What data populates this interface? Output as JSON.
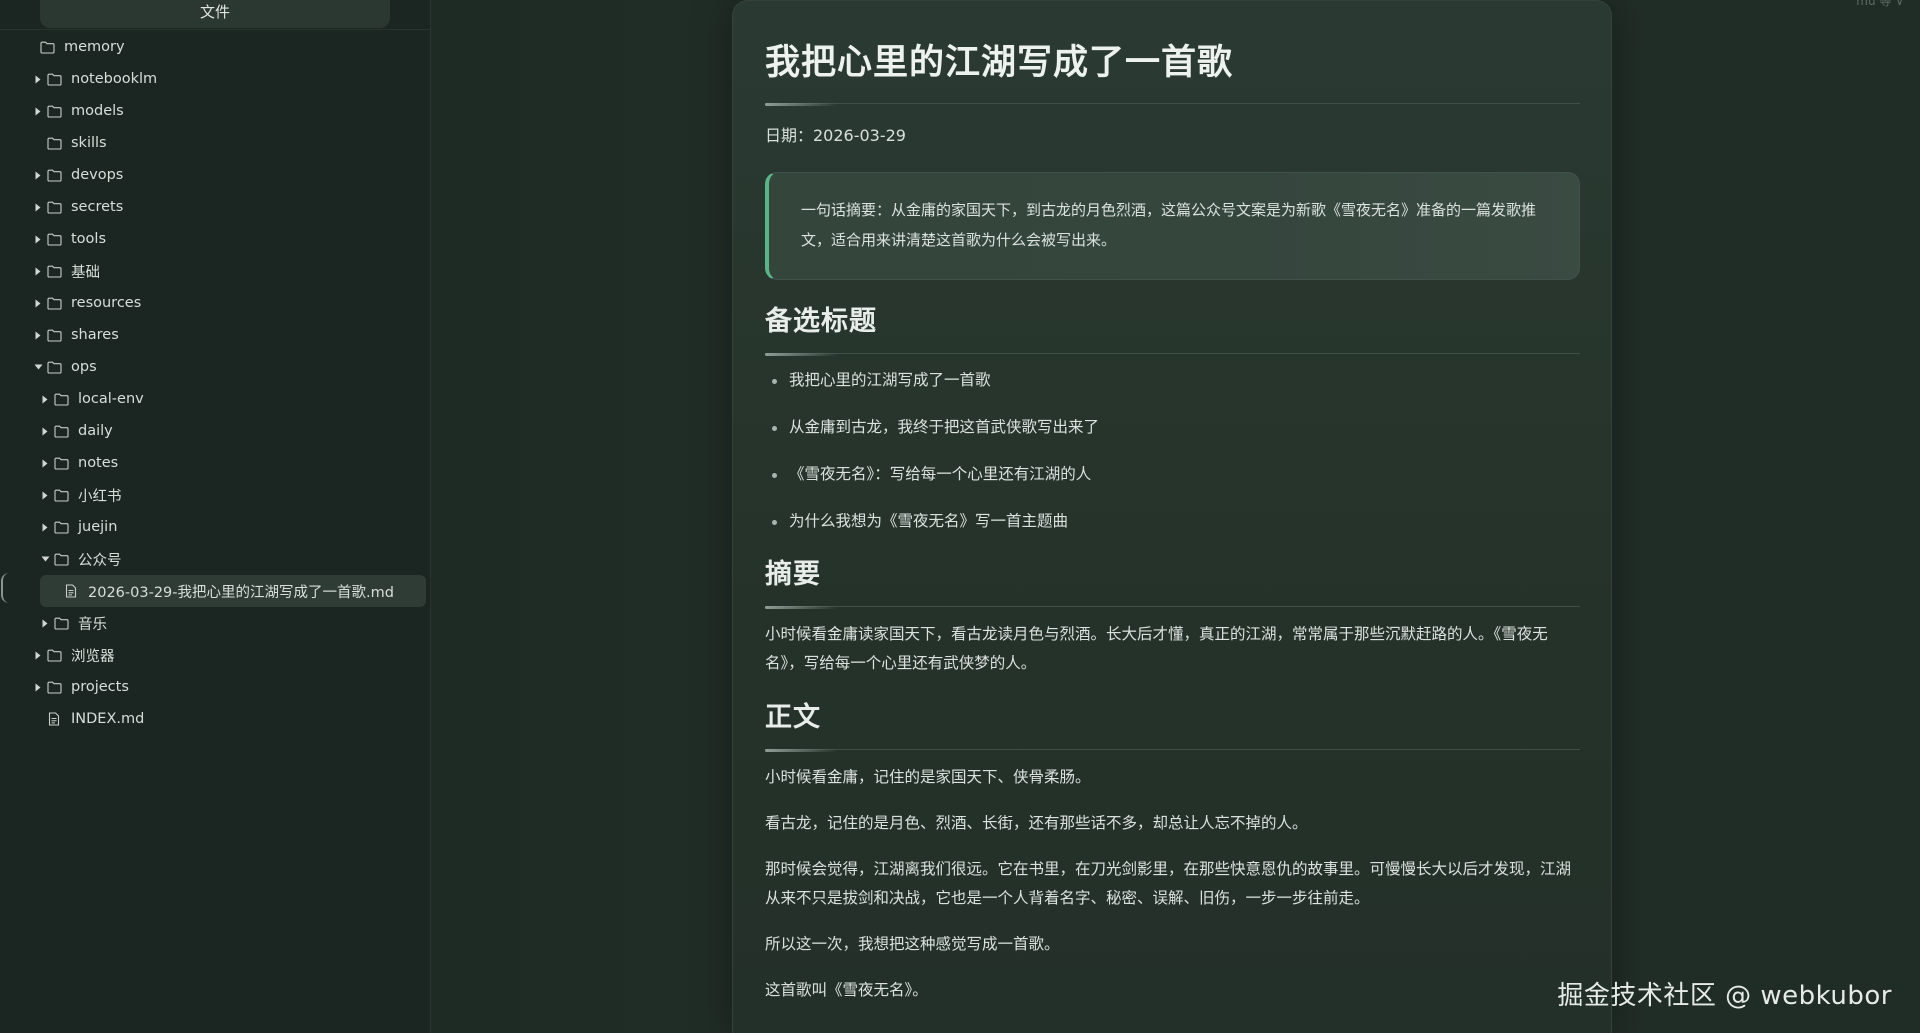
{
  "sidebar": {
    "files_tab_label": "文件",
    "tree": [
      {
        "label": "memory",
        "indent": 0,
        "type": "folder",
        "caret": "none"
      },
      {
        "label": "notebooklm",
        "indent": 1,
        "type": "folder",
        "caret": "collapsed"
      },
      {
        "label": "models",
        "indent": 1,
        "type": "folder",
        "caret": "collapsed"
      },
      {
        "label": "skills",
        "indent": 1,
        "type": "folder",
        "caret": "none"
      },
      {
        "label": "devops",
        "indent": 1,
        "type": "folder",
        "caret": "collapsed"
      },
      {
        "label": "secrets",
        "indent": 1,
        "type": "folder",
        "caret": "collapsed"
      },
      {
        "label": "tools",
        "indent": 1,
        "type": "folder",
        "caret": "collapsed"
      },
      {
        "label": "基础",
        "indent": 1,
        "type": "folder",
        "caret": "collapsed"
      },
      {
        "label": "resources",
        "indent": 1,
        "type": "folder",
        "caret": "collapsed"
      },
      {
        "label": "shares",
        "indent": 1,
        "type": "folder",
        "caret": "collapsed"
      },
      {
        "label": "ops",
        "indent": 1,
        "type": "folder",
        "caret": "expanded"
      },
      {
        "label": "local-env",
        "indent": 2,
        "type": "folder",
        "caret": "collapsed"
      },
      {
        "label": "daily",
        "indent": 2,
        "type": "folder",
        "caret": "collapsed"
      },
      {
        "label": "notes",
        "indent": 2,
        "type": "folder",
        "caret": "collapsed"
      },
      {
        "label": "小红书",
        "indent": 2,
        "type": "folder",
        "caret": "collapsed"
      },
      {
        "label": "juejin",
        "indent": 2,
        "type": "folder",
        "caret": "collapsed"
      },
      {
        "label": "公众号",
        "indent": 2,
        "type": "folder",
        "caret": "expanded"
      },
      {
        "label": "2026-03-29-我把心里的江湖写成了一首歌.md",
        "indent": 3,
        "type": "file",
        "caret": "none",
        "active": true
      },
      {
        "label": "音乐",
        "indent": 2,
        "type": "folder",
        "caret": "collapsed"
      },
      {
        "label": "浏览器",
        "indent": 1,
        "type": "folder",
        "caret": "collapsed"
      },
      {
        "label": "projects",
        "indent": 1,
        "type": "folder",
        "caret": "collapsed"
      },
      {
        "label": "INDEX.md",
        "indent": 1,
        "type": "file",
        "caret": "none"
      }
    ]
  },
  "editor": {
    "top_right_hint": "mu 等 ∨"
  },
  "document": {
    "title": "我把心里的江湖写成了一首歌",
    "date_line": "日期：2026-03-29",
    "summary_callout": "一句话摘要：从金庸的家国天下，到古龙的月色烈酒，这篇公众号文案是为新歌《雪夜无名》准备的一篇发歌推文，适合用来讲清楚这首歌为什么会被写出来。",
    "section_alt_titles": {
      "heading": "备选标题",
      "items": [
        "我把心里的江湖写成了一首歌",
        "从金庸到古龙，我终于把这首武侠歌写出来了",
        "《雪夜无名》：写给每一个心里还有江湖的人",
        "为什么我想为《雪夜无名》写一首主题曲"
      ]
    },
    "section_summary": {
      "heading": "摘要",
      "text": "小时候看金庸读家国天下，看古龙读月色与烈酒。长大后才懂，真正的江湖，常常属于那些沉默赶路的人。《雪夜无名》，写给每一个心里还有武侠梦的人。"
    },
    "section_body": {
      "heading": "正文",
      "paragraphs": [
        "小时候看金庸，记住的是家国天下、侠骨柔肠。",
        "看古龙，记住的是月色、烈酒、长街，还有那些话不多，却总让人忘不掉的人。",
        "那时候会觉得，江湖离我们很远。它在书里，在刀光剑影里，在那些快意恩仇的故事里。可慢慢长大以后才发现，江湖从来不只是拔剑和决战，它也是一个人背着名字、秘密、误解、旧伤，一步一步往前走。",
        "所以这一次，我想把这种感觉写成一首歌。",
        "这首歌叫《雪夜无名》。"
      ]
    }
  },
  "watermark": "掘金技术社区 @ webkubor",
  "colors": {
    "accent_green": "#59b486",
    "background": "#1f2b25",
    "sidebar_bg": "#1b2521",
    "doc_bg": "#2a3a32"
  }
}
